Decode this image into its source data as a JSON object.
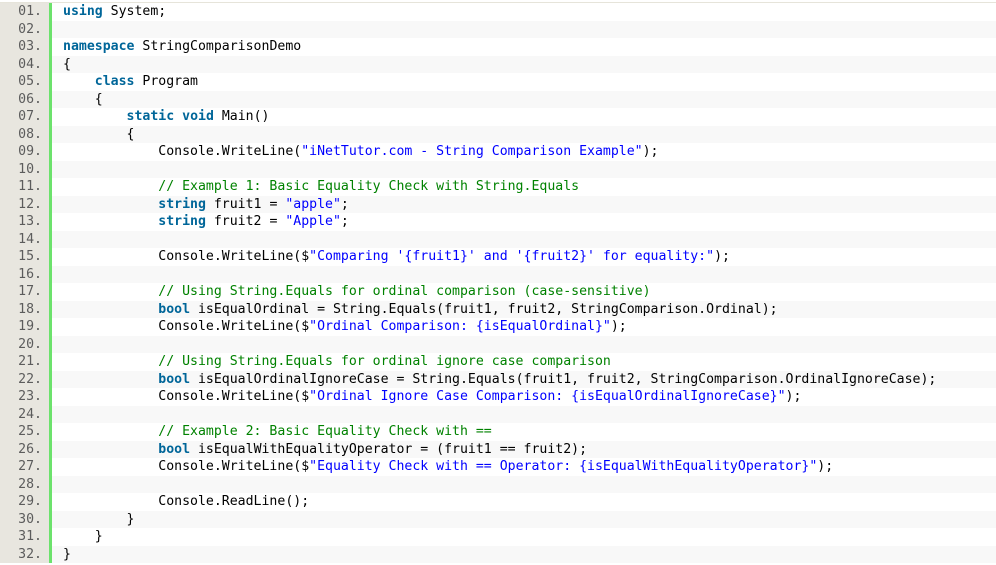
{
  "language": "csharp",
  "colors": {
    "keyword": "#006699",
    "string": "#0000ff",
    "comment": "#008200",
    "plain": "#000000",
    "gutter_bg": "#e8e6df",
    "gutter_border": "#6ce26c",
    "alt_row_bg": "#f8f8f8"
  },
  "lines": [
    {
      "num": "01.",
      "indent": 0,
      "tokens": [
        {
          "t": "kw",
          "v": "using"
        },
        {
          "t": "pl",
          "v": " System;"
        }
      ]
    },
    {
      "num": "02.",
      "indent": 0,
      "tokens": []
    },
    {
      "num": "03.",
      "indent": 0,
      "tokens": [
        {
          "t": "kw",
          "v": "namespace"
        },
        {
          "t": "pl",
          "v": " StringComparisonDemo"
        }
      ]
    },
    {
      "num": "04.",
      "indent": 0,
      "tokens": [
        {
          "t": "pl",
          "v": "{"
        }
      ]
    },
    {
      "num": "05.",
      "indent": 1,
      "tokens": [
        {
          "t": "kw",
          "v": "class"
        },
        {
          "t": "pl",
          "v": " Program"
        }
      ]
    },
    {
      "num": "06.",
      "indent": 1,
      "tokens": [
        {
          "t": "pl",
          "v": "{"
        }
      ]
    },
    {
      "num": "07.",
      "indent": 2,
      "tokens": [
        {
          "t": "kw",
          "v": "static"
        },
        {
          "t": "pl",
          "v": " "
        },
        {
          "t": "kw",
          "v": "void"
        },
        {
          "t": "pl",
          "v": " Main()"
        }
      ]
    },
    {
      "num": "08.",
      "indent": 2,
      "tokens": [
        {
          "t": "pl",
          "v": "{"
        }
      ]
    },
    {
      "num": "09.",
      "indent": 3,
      "tokens": [
        {
          "t": "pl",
          "v": "Console.WriteLine("
        },
        {
          "t": "str",
          "v": "\"iNetTutor.com - String Comparison Example\""
        },
        {
          "t": "pl",
          "v": ");"
        }
      ]
    },
    {
      "num": "10.",
      "indent": 0,
      "tokens": []
    },
    {
      "num": "11.",
      "indent": 3,
      "tokens": [
        {
          "t": "cm",
          "v": "// Example 1: Basic Equality Check with String.Equals"
        }
      ]
    },
    {
      "num": "12.",
      "indent": 3,
      "tokens": [
        {
          "t": "kw",
          "v": "string"
        },
        {
          "t": "pl",
          "v": " fruit1 = "
        },
        {
          "t": "str",
          "v": "\"apple\""
        },
        {
          "t": "pl",
          "v": ";"
        }
      ]
    },
    {
      "num": "13.",
      "indent": 3,
      "tokens": [
        {
          "t": "kw",
          "v": "string"
        },
        {
          "t": "pl",
          "v": " fruit2 = "
        },
        {
          "t": "str",
          "v": "\"Apple\""
        },
        {
          "t": "pl",
          "v": ";"
        }
      ]
    },
    {
      "num": "14.",
      "indent": 0,
      "tokens": []
    },
    {
      "num": "15.",
      "indent": 3,
      "tokens": [
        {
          "t": "pl",
          "v": "Console.WriteLine($"
        },
        {
          "t": "str",
          "v": "\"Comparing '{fruit1}' and '{fruit2}' for equality:\""
        },
        {
          "t": "pl",
          "v": ");"
        }
      ]
    },
    {
      "num": "16.",
      "indent": 0,
      "tokens": []
    },
    {
      "num": "17.",
      "indent": 3,
      "tokens": [
        {
          "t": "cm",
          "v": "// Using String.Equals for ordinal comparison (case-sensitive)"
        }
      ]
    },
    {
      "num": "18.",
      "indent": 3,
      "tokens": [
        {
          "t": "kw",
          "v": "bool"
        },
        {
          "t": "pl",
          "v": " isEqualOrdinal = String.Equals(fruit1, fruit2, StringComparison.Ordinal);"
        }
      ]
    },
    {
      "num": "19.",
      "indent": 3,
      "tokens": [
        {
          "t": "pl",
          "v": "Console.WriteLine($"
        },
        {
          "t": "str",
          "v": "\"Ordinal Comparison: {isEqualOrdinal}\""
        },
        {
          "t": "pl",
          "v": ");"
        }
      ]
    },
    {
      "num": "20.",
      "indent": 0,
      "tokens": []
    },
    {
      "num": "21.",
      "indent": 3,
      "tokens": [
        {
          "t": "cm",
          "v": "// Using String.Equals for ordinal ignore case comparison"
        }
      ]
    },
    {
      "num": "22.",
      "indent": 3,
      "tokens": [
        {
          "t": "kw",
          "v": "bool"
        },
        {
          "t": "pl",
          "v": " isEqualOrdinalIgnoreCase = String.Equals(fruit1, fruit2, StringComparison.OrdinalIgnoreCase);"
        }
      ]
    },
    {
      "num": "23.",
      "indent": 3,
      "tokens": [
        {
          "t": "pl",
          "v": "Console.WriteLine($"
        },
        {
          "t": "str",
          "v": "\"Ordinal Ignore Case Comparison: {isEqualOrdinalIgnoreCase}\""
        },
        {
          "t": "pl",
          "v": ");"
        }
      ]
    },
    {
      "num": "24.",
      "indent": 0,
      "tokens": []
    },
    {
      "num": "25.",
      "indent": 3,
      "tokens": [
        {
          "t": "cm",
          "v": "// Example 2: Basic Equality Check with =="
        }
      ]
    },
    {
      "num": "26.",
      "indent": 3,
      "tokens": [
        {
          "t": "kw",
          "v": "bool"
        },
        {
          "t": "pl",
          "v": " isEqualWithEqualityOperator = (fruit1 == fruit2);"
        }
      ]
    },
    {
      "num": "27.",
      "indent": 3,
      "tokens": [
        {
          "t": "pl",
          "v": "Console.WriteLine($"
        },
        {
          "t": "str",
          "v": "\"Equality Check with == Operator: {isEqualWithEqualityOperator}\""
        },
        {
          "t": "pl",
          "v": ");"
        }
      ]
    },
    {
      "num": "28.",
      "indent": 0,
      "tokens": []
    },
    {
      "num": "29.",
      "indent": 3,
      "tokens": [
        {
          "t": "pl",
          "v": "Console.ReadLine();"
        }
      ]
    },
    {
      "num": "30.",
      "indent": 2,
      "tokens": [
        {
          "t": "pl",
          "v": "}"
        }
      ]
    },
    {
      "num": "31.",
      "indent": 1,
      "tokens": [
        {
          "t": "pl",
          "v": "}"
        }
      ]
    },
    {
      "num": "32.",
      "indent": 0,
      "tokens": [
        {
          "t": "pl",
          "v": "}"
        }
      ]
    }
  ]
}
